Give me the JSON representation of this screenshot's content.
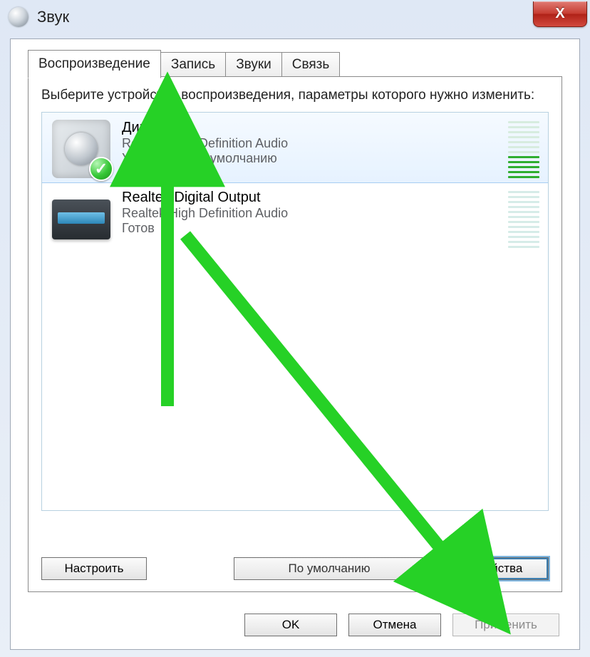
{
  "window": {
    "title": "Звук"
  },
  "close_button": {
    "glyph": "X"
  },
  "tabs": {
    "playback": "Воспроизведение",
    "recording": "Запись",
    "sounds": "Звуки",
    "communications": "Связь"
  },
  "instruction": "Выберите устройство воспроизведения, параметры которого нужно изменить:",
  "devices": [
    {
      "name": "Динамики",
      "driver": "Realtek High Definition Audio",
      "status": "Устройство по умолчанию",
      "default": true,
      "selected": true
    },
    {
      "name": "Realtek Digital Output",
      "driver": "Realtek High Definition Audio",
      "status": "Готов",
      "default": false,
      "selected": false
    }
  ],
  "buttons": {
    "configure": "Настроить",
    "set_default": "По умолчанию",
    "properties": "Свойства",
    "ok": "OK",
    "cancel": "Отмена",
    "apply": "Применить"
  },
  "annotations": {
    "arrow_color": "#26d126"
  }
}
